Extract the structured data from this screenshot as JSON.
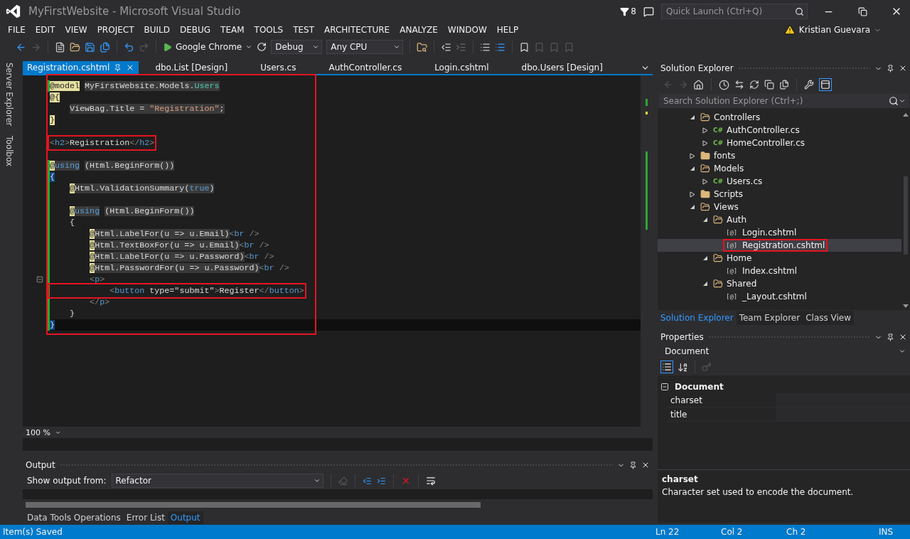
{
  "window": {
    "title": "MyFirstWebsite - Microsoft Visual Studio",
    "notifications": "8",
    "quick_launch": {
      "placeholder": "Quick Launch (Ctrl+Q)"
    },
    "user": "Kristian Guevara"
  },
  "menu": [
    "FILE",
    "EDIT",
    "VIEW",
    "PROJECT",
    "BUILD",
    "DEBUG",
    "TEAM",
    "TOOLS",
    "TEST",
    "ARCHITECTURE",
    "ANALYZE",
    "WINDOW",
    "HELP"
  ],
  "toolbar": {
    "run_target": "Google Chrome",
    "configuration": "Debug",
    "platform": "Any CPU"
  },
  "side_strip": [
    "Server Explorer",
    "Toolbox"
  ],
  "editor_tabs": [
    {
      "label": "Registration.cshtml",
      "selected": true
    },
    {
      "label": "dbo.List [Design]",
      "selected": false
    },
    {
      "label": "Users.cs",
      "selected": false
    },
    {
      "label": "AuthController.cs",
      "selected": false
    },
    {
      "label": "Login.cshtml",
      "selected": false
    },
    {
      "label": "dbo.Users [Design]",
      "selected": false
    }
  ],
  "code": {
    "outlined": true,
    "lines": [
      {
        "changed": true,
        "tokens": [
          {
            "kind": "at",
            "text": "@model"
          },
          {
            "kind": "code",
            "text": " MyFirstWebsite.Models."
          },
          {
            "kind": "type",
            "text": "Users"
          }
        ]
      },
      {
        "changed": false,
        "tokens": [
          {
            "kind": "at",
            "text": "@{"
          }
        ]
      },
      {
        "changed": false,
        "tokens": [
          {
            "kind": "code",
            "text": "    ViewBag.Title = "
          },
          {
            "kind": "string",
            "text": "\"Registration\""
          },
          {
            "kind": "code",
            "text": ";"
          }
        ]
      },
      {
        "changed": false,
        "tokens": [
          {
            "kind": "at",
            "text": "}"
          }
        ]
      },
      {
        "changed": false
      },
      {
        "changed": false,
        "outlined": true,
        "tokens": [
          {
            "kind": "bracket",
            "text": "<"
          },
          {
            "kind": "tag",
            "text": "h2"
          },
          {
            "kind": "bracket",
            "text": ">"
          },
          {
            "kind": "plain",
            "text": "Registration"
          },
          {
            "kind": "bracket",
            "text": "</"
          },
          {
            "kind": "tag",
            "text": "h2"
          },
          {
            "kind": "bracket",
            "text": ">"
          }
        ]
      },
      {
        "changed": false
      },
      {
        "changed": true,
        "tokens": [
          {
            "kind": "at",
            "text": "@"
          },
          {
            "kind": "keyword",
            "text": "using"
          },
          {
            "kind": "code",
            "text": " (Html.BeginForm())"
          }
        ]
      },
      {
        "changed": true,
        "tokens": [
          {
            "kind": "match",
            "text": "{"
          }
        ]
      },
      {
        "changed": true,
        "tokens": [
          {
            "kind": "at",
            "text": "    @"
          },
          {
            "kind": "code",
            "text": "Html.ValidationSummary("
          },
          {
            "kind": "keyword",
            "text": "true"
          },
          {
            "kind": "code",
            "text": ")"
          }
        ]
      },
      {
        "changed": true
      },
      {
        "changed": true,
        "tokens": [
          {
            "kind": "at",
            "text": "    @"
          },
          {
            "kind": "keyword",
            "text": "using"
          },
          {
            "kind": "code",
            "text": " (Html.BeginForm())"
          }
        ]
      },
      {
        "changed": true,
        "tokens": [
          {
            "kind": "plain",
            "text": "    {"
          }
        ]
      },
      {
        "changed": true,
        "tokens": [
          {
            "kind": "at",
            "text": "        @"
          },
          {
            "kind": "code",
            "text": "Html.LabelFor(u => u.Email)"
          },
          {
            "kind": "bracket",
            "text": "<"
          },
          {
            "kind": "tag",
            "text": "br"
          },
          {
            "kind": "bracket",
            "text": " />"
          }
        ]
      },
      {
        "changed": true,
        "tokens": [
          {
            "kind": "at",
            "text": "        @"
          },
          {
            "kind": "code",
            "text": "Html.TextBoxFor(u => u.Email)"
          },
          {
            "kind": "bracket",
            "text": "<"
          },
          {
            "kind": "tag",
            "text": "br"
          },
          {
            "kind": "bracket",
            "text": " />"
          }
        ]
      },
      {
        "changed": true,
        "tokens": [
          {
            "kind": "at",
            "text": "        @"
          },
          {
            "kind": "code",
            "text": "Html.LabelFor(u => u.Password)"
          },
          {
            "kind": "bracket",
            "text": "<"
          },
          {
            "kind": "tag",
            "text": "br"
          },
          {
            "kind": "bracket",
            "text": " />"
          }
        ]
      },
      {
        "changed": true,
        "tokens": [
          {
            "kind": "at",
            "text": "        @"
          },
          {
            "kind": "code",
            "text": "Html.PasswordFor(u => u.Password)"
          },
          {
            "kind": "bracket",
            "text": "<"
          },
          {
            "kind": "tag",
            "text": "br"
          },
          {
            "kind": "bracket",
            "text": " />"
          }
        ]
      },
      {
        "changed": true,
        "foldable": true,
        "tokens": [
          {
            "kind": "bracket",
            "text": "        <"
          },
          {
            "kind": "tag",
            "text": "p"
          },
          {
            "kind": "bracket",
            "text": ">"
          }
        ]
      },
      {
        "changed": true,
        "outlined": true,
        "tokens": [
          {
            "kind": "bracket",
            "text": "            <"
          },
          {
            "kind": "tag",
            "text": "button"
          },
          {
            "kind": "plain",
            "text": " type=\"submit\""
          },
          {
            "kind": "bracket",
            "text": ">"
          },
          {
            "kind": "plain",
            "text": "Register"
          },
          {
            "kind": "bracket",
            "text": "</"
          },
          {
            "kind": "tag",
            "text": "button"
          },
          {
            "kind": "bracket",
            "text": ">"
          }
        ]
      },
      {
        "changed": true,
        "tokens": [
          {
            "kind": "bracket",
            "text": "        </"
          },
          {
            "kind": "tag",
            "text": "p"
          },
          {
            "kind": "bracket",
            "text": ">"
          }
        ]
      },
      {
        "changed": true,
        "tokens": [
          {
            "kind": "plain",
            "text": "    }"
          }
        ]
      },
      {
        "changed": true,
        "current": true,
        "tokens": [
          {
            "kind": "match",
            "text": "}"
          }
        ]
      }
    ]
  },
  "zoom": "100 %",
  "output": {
    "title": "Output",
    "source_label": "Show output from:",
    "source": "Refactor"
  },
  "bottom_tabs": [
    {
      "label": "Data Tools Operations",
      "selected": false
    },
    {
      "label": "Error List",
      "selected": false
    },
    {
      "label": "Output",
      "selected": true
    }
  ],
  "solution_explorer": {
    "title": "Solution Explorer",
    "search": {
      "placeholder": "Search Solution Explorer (Ctrl+;)"
    },
    "tree": [
      {
        "label": "Controllers",
        "kind": "folder",
        "expanded": true,
        "children": [
          {
            "label": "AuthController.cs",
            "kind": "csharp",
            "icon_text": "C#",
            "expanded": false
          },
          {
            "label": "HomeController.cs",
            "kind": "csharp",
            "icon_text": "C#",
            "expanded": false
          }
        ]
      },
      {
        "label": "fonts",
        "kind": "folder",
        "expanded": false
      },
      {
        "label": "Models",
        "kind": "folder",
        "expanded": true,
        "children": [
          {
            "label": "Users.cs",
            "kind": "csharp",
            "icon_text": "C#",
            "expanded": false
          }
        ]
      },
      {
        "label": "Scripts",
        "kind": "folder",
        "expanded": false
      },
      {
        "label": "Views",
        "kind": "folder",
        "expanded": true,
        "children": [
          {
            "label": "Auth",
            "kind": "folder",
            "expanded": true,
            "children": [
              {
                "label": "Login.cshtml",
                "kind": "razor",
                "icon_text": "[@]",
                "selected": false,
                "outlined": false
              },
              {
                "label": "Registration.cshtml",
                "kind": "razor",
                "icon_text": "[@]",
                "selected": true,
                "outlined": true
              }
            ]
          },
          {
            "label": "Home",
            "kind": "folder",
            "expanded": true,
            "children": [
              {
                "label": "Index.cshtml",
                "kind": "razor",
                "icon_text": "[@]",
                "selected": false,
                "outlined": false
              }
            ]
          },
          {
            "label": "Shared",
            "kind": "folder",
            "expanded": true,
            "children": [
              {
                "label": "_Layout.cshtml",
                "kind": "razor",
                "icon_text": "[@]",
                "selected": false,
                "outlined": false
              }
            ]
          }
        ]
      }
    ],
    "tabs": [
      {
        "label": "Solution Explorer",
        "selected": true
      },
      {
        "label": "Team Explorer",
        "selected": false
      },
      {
        "label": "Class View",
        "selected": false
      }
    ]
  },
  "properties": {
    "title": "Properties",
    "object": "Document",
    "category": {
      "label": "Document",
      "expanded": true
    },
    "rows": [
      "charset",
      "title"
    ],
    "description": {
      "title": "charset",
      "text": "Character set used to encode the document."
    }
  },
  "status_bar": {
    "message": "Item(s) Saved",
    "line": "Ln 22",
    "column": "Col 2",
    "char": "Ch 2",
    "mode": "INS"
  }
}
